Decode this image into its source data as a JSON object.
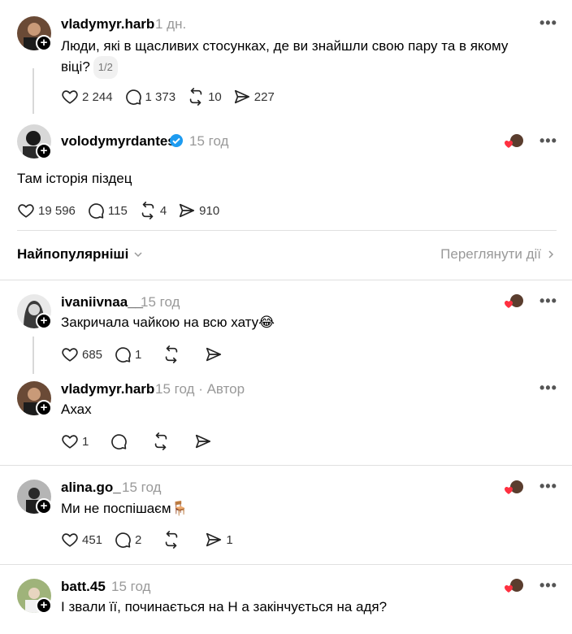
{
  "original_post": {
    "username": "vladymyr.harb",
    "time": "1 дн.",
    "text": "Люди, які в щасливих стосунках, де ви знайшли свою пару та в якому віці?",
    "page_indicator": "1/2",
    "likes": "2 244",
    "replies": "1 373",
    "reposts": "10",
    "shares": "227"
  },
  "reply_post": {
    "username": "volodymyrdantes",
    "time": "15 год",
    "text": "Там історія піздец",
    "likes": "19 596",
    "replies": "115",
    "reposts": "4",
    "shares": "910"
  },
  "sort_bar": {
    "label": "Найпопулярніші",
    "view_activity": "Переглянути дії"
  },
  "comments": [
    {
      "username": "ivaniivnaa__",
      "time": "15 год",
      "text": "Закричала чайкою на всю хату",
      "emoji": "😂",
      "likes": "685",
      "replies": "1",
      "reposts": "",
      "shares": ""
    },
    {
      "username": "vladymyr.harb",
      "time": "15 год",
      "author_label": "Автор",
      "text": "Ахах",
      "likes": "1",
      "replies": "",
      "reposts": "",
      "shares": ""
    },
    {
      "username": "alina.go_",
      "time": "15 год",
      "text": "Ми не поспішаєм",
      "emoji": "🪑",
      "likes": "451",
      "replies": "2",
      "reposts": "",
      "shares": "1"
    },
    {
      "username": "batt.45",
      "time": "15 год",
      "text": "І звали її, починається на Н а закінчується на адя?"
    }
  ],
  "icons": {
    "more": "more-dots-icon",
    "like": "heart-icon",
    "reply": "comment-icon",
    "repost": "repost-icon",
    "share": "send-icon",
    "verified": "verified-badge-icon"
  },
  "colors": {
    "verified_blue": "#1d9bf0",
    "like_red": "#ff3040",
    "muted": "#999999"
  }
}
